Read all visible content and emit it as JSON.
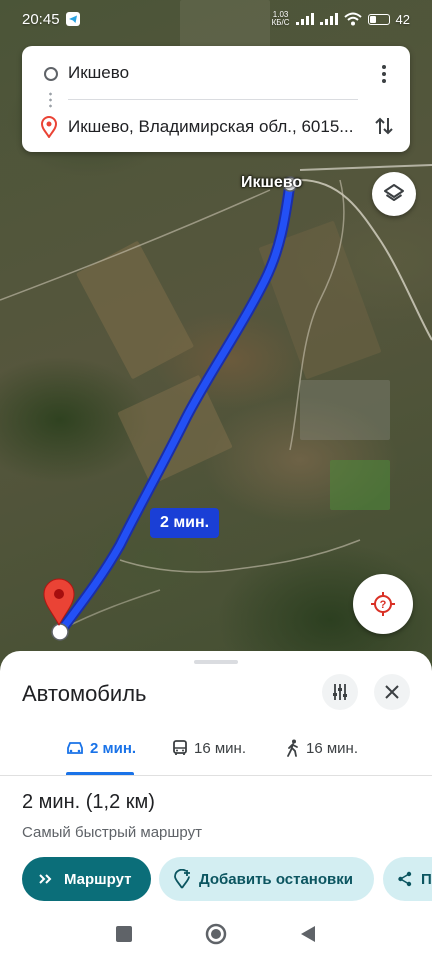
{
  "status_bar": {
    "time": "20:45",
    "net_speed_value": "1.03",
    "net_speed_unit": "КБ/С",
    "battery": "42",
    "battery_fill": 0.42
  },
  "route_card": {
    "origin": "Икшево",
    "destination": "Икшево, Владимирская обл., 6015..."
  },
  "map": {
    "place_label": "Икшево",
    "route_duration": "2 мин.",
    "route_color": "#1a3fd6"
  },
  "sheet": {
    "title": "Автомобиль",
    "modes": [
      {
        "icon": "car-icon",
        "label": "2 мин."
      },
      {
        "icon": "bus-icon",
        "label": "16 мин."
      },
      {
        "icon": "walk-icon",
        "label": "16 мин."
      }
    ],
    "summary": "2 мин. (1,2 км)",
    "subtitle": "Самый быстрый маршрут",
    "start_label": "Маршрут",
    "add_stops_label": "Добавить остановки",
    "share_label": "П"
  },
  "colors": {
    "accent": "#1a73e8",
    "start_button": "#0b6e79",
    "chip_bg": "#d3eef2",
    "pin": "#ea4335"
  }
}
